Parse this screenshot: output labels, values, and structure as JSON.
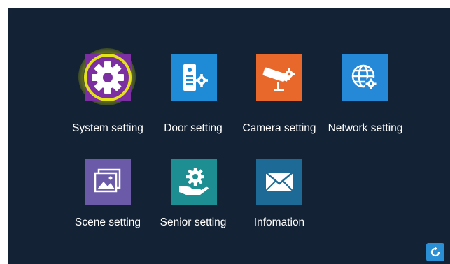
{
  "menu": {
    "items": [
      {
        "label": "System setting",
        "icon": "gear-icon",
        "selected": true
      },
      {
        "label": "Door setting",
        "icon": "door-phone-icon"
      },
      {
        "label": "Camera setting",
        "icon": "camera-icon"
      },
      {
        "label": "Network setting",
        "icon": "globe-icon"
      },
      {
        "label": "Scene setting",
        "icon": "picture-icon"
      },
      {
        "label": "Senior setting",
        "icon": "hand-gear-icon"
      },
      {
        "label": "Infomation",
        "icon": "envelope-icon"
      }
    ]
  },
  "footer": {
    "refresh_icon": "refresh-icon"
  },
  "colors": {
    "background": "#132235",
    "system": "#7b2fa0",
    "door": "#1f8ad6",
    "camera": "#e8672a",
    "network": "#2589d8",
    "scene": "#6b5aa8",
    "senior": "#1d8f93",
    "info": "#1c6a95",
    "selection": "#e4e21a"
  }
}
